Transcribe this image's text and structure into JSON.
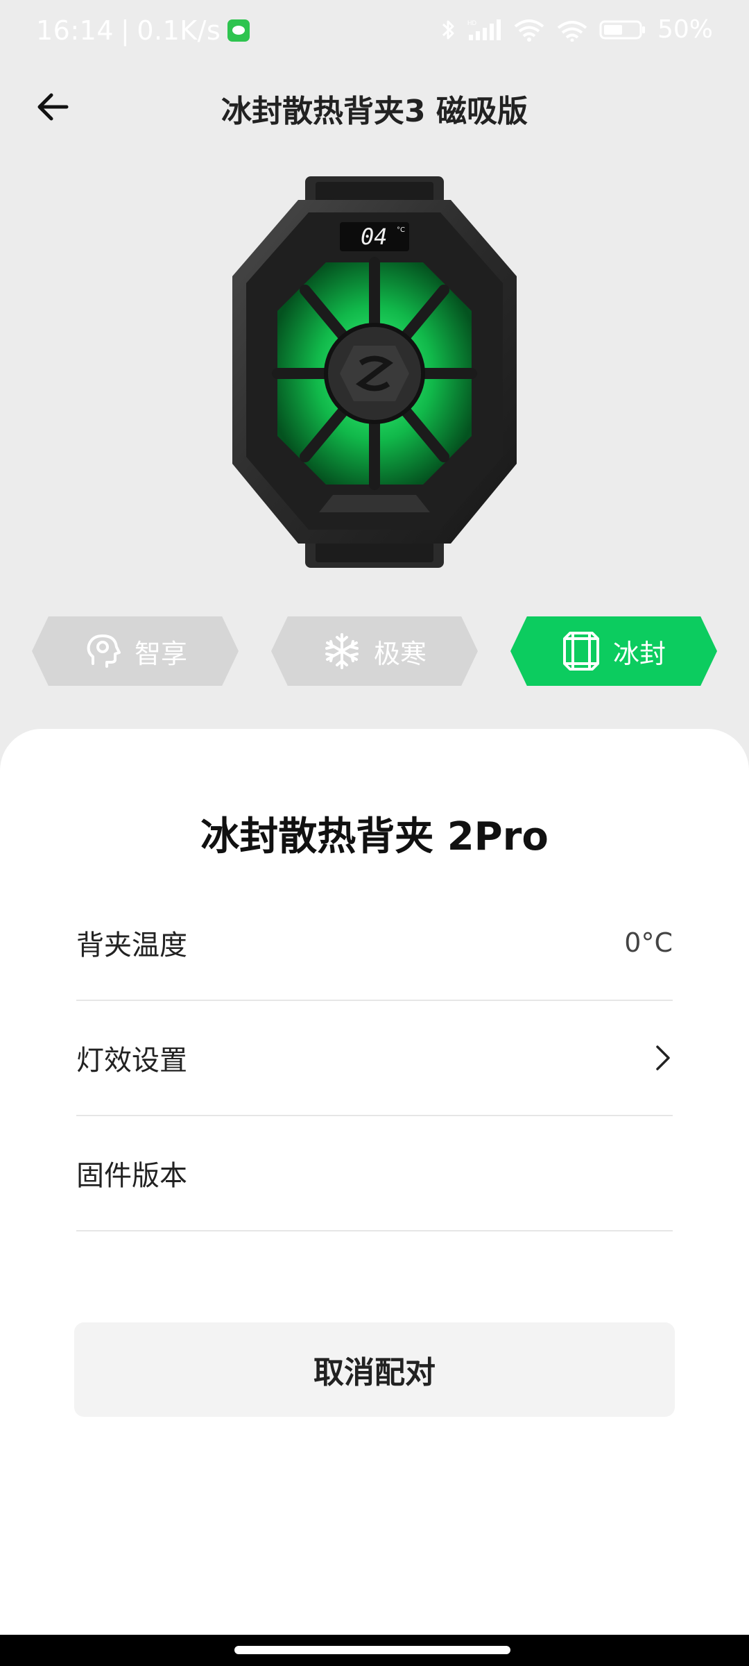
{
  "status_bar": {
    "time": "16:14",
    "separator": "|",
    "net_speed": "0.1K/s",
    "battery": "50%"
  },
  "header": {
    "title": "冰封散热背夹3 磁吸版"
  },
  "product": {
    "display_digits": "04"
  },
  "modes": [
    {
      "label": "智享",
      "icon": "smart-head-icon",
      "active": false
    },
    {
      "label": "极寒",
      "icon": "snowflake-icon",
      "active": false
    },
    {
      "label": "冰封",
      "icon": "ice-cube-icon",
      "active": true
    }
  ],
  "colors": {
    "accent": "#0ccc5f",
    "mode_inactive": "#d6d6d6",
    "background": "#ececec"
  },
  "sheet": {
    "title": "冰封散热背夹 2Pro",
    "rows": [
      {
        "label": "背夹温度",
        "value": "0°C"
      },
      {
        "label": "灯效设置",
        "value": ""
      },
      {
        "label": "固件版本",
        "value": ""
      }
    ],
    "unpair_label": "取消配对"
  }
}
